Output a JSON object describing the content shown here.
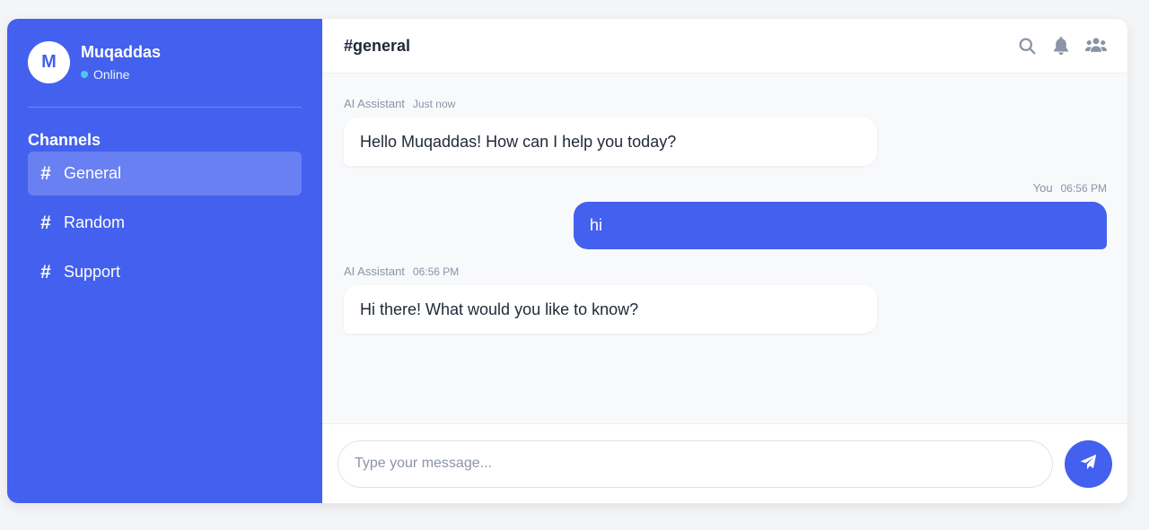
{
  "colors": {
    "primary": "#4361ee",
    "online": "#4cc9f0",
    "muted": "#8a94a6"
  },
  "user": {
    "initial": "M",
    "name": "Muqaddas",
    "status": "Online"
  },
  "sidebar": {
    "section_title": "Channels",
    "channels": [
      {
        "label": "General",
        "icon": "hash-icon",
        "active": true
      },
      {
        "label": "Random",
        "icon": "hash-icon",
        "active": false
      },
      {
        "label": "Support",
        "icon": "hash-icon",
        "active": false
      }
    ]
  },
  "header": {
    "title": "#general",
    "icons": [
      "search-icon",
      "bell-icon",
      "users-icon"
    ]
  },
  "messages": [
    {
      "direction": "in",
      "sender": "AI Assistant",
      "time": "Just now",
      "text": "Hello Muqaddas! How can I help you today?"
    },
    {
      "direction": "out",
      "sender": "You",
      "time": "06:56 PM",
      "text": "hi"
    },
    {
      "direction": "in",
      "sender": "AI Assistant",
      "time": "06:56 PM",
      "text": "Hi there! What would you like to know?"
    }
  ],
  "composer": {
    "placeholder": "Type your message...",
    "value": "",
    "send_icon": "paper-plane-icon"
  }
}
